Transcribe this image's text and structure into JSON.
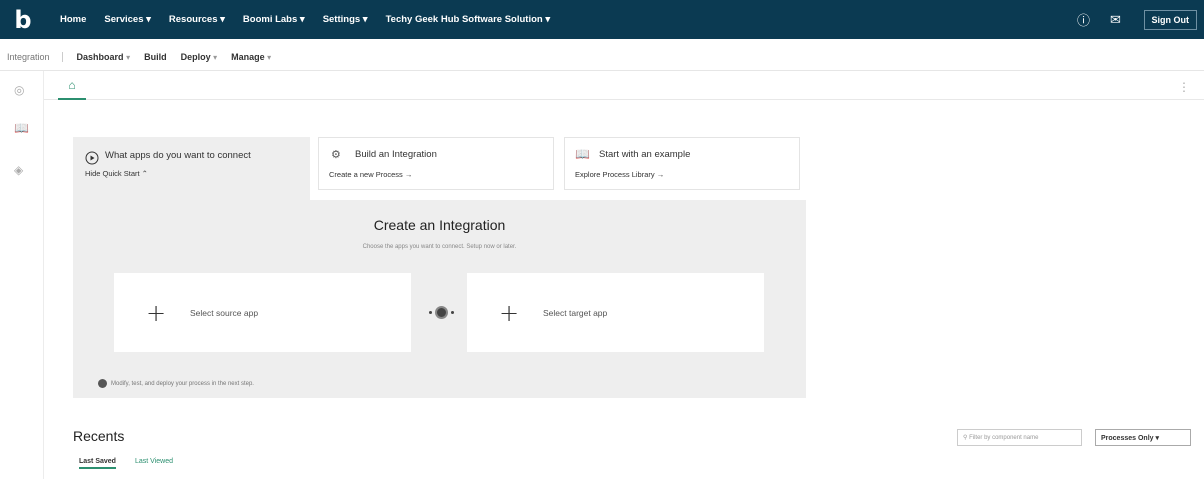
{
  "topbar": {
    "logo": "b",
    "nav": [
      "Home",
      "Services ▾",
      "Resources ▾",
      "Boomi Labs ▾",
      "Settings ▾",
      "Techy Geek Hub Software Solution ▾"
    ],
    "help_icon": "ⓘ",
    "mail_icon": "✉",
    "signout": "Sign Out"
  },
  "subnav": {
    "integration": "Integration",
    "dashboard": "Dashboard",
    "build": "Build",
    "deploy": "Deploy",
    "manage": "Manage",
    "caret": "▾"
  },
  "quickstart": {
    "tab1_title": "What apps do you want to connect",
    "tab1_link": "Hide Quick Start ⌃",
    "tab2_title": "Build an Integration",
    "tab2_link": "Create a new Process →",
    "tab3_title": "Start with an example",
    "tab3_link": "Explore Process Library →"
  },
  "create": {
    "title": "Create an Integration",
    "subtitle": "Choose the apps you want to connect. Setup now or later.",
    "source_label": "Select source app",
    "target_label": "Select target app",
    "note": "Modify, test, and deploy your process in the next step."
  },
  "recents": {
    "title": "Recents",
    "tab_saved": "Last Saved",
    "tab_viewed": "Last Viewed",
    "filter_placeholder": "Filter by component name",
    "select_value": "Processes Only ▾"
  },
  "colors": {
    "topbar": "#0b3a52",
    "accent": "#2b8f6f",
    "panel": "#eeeeee"
  }
}
